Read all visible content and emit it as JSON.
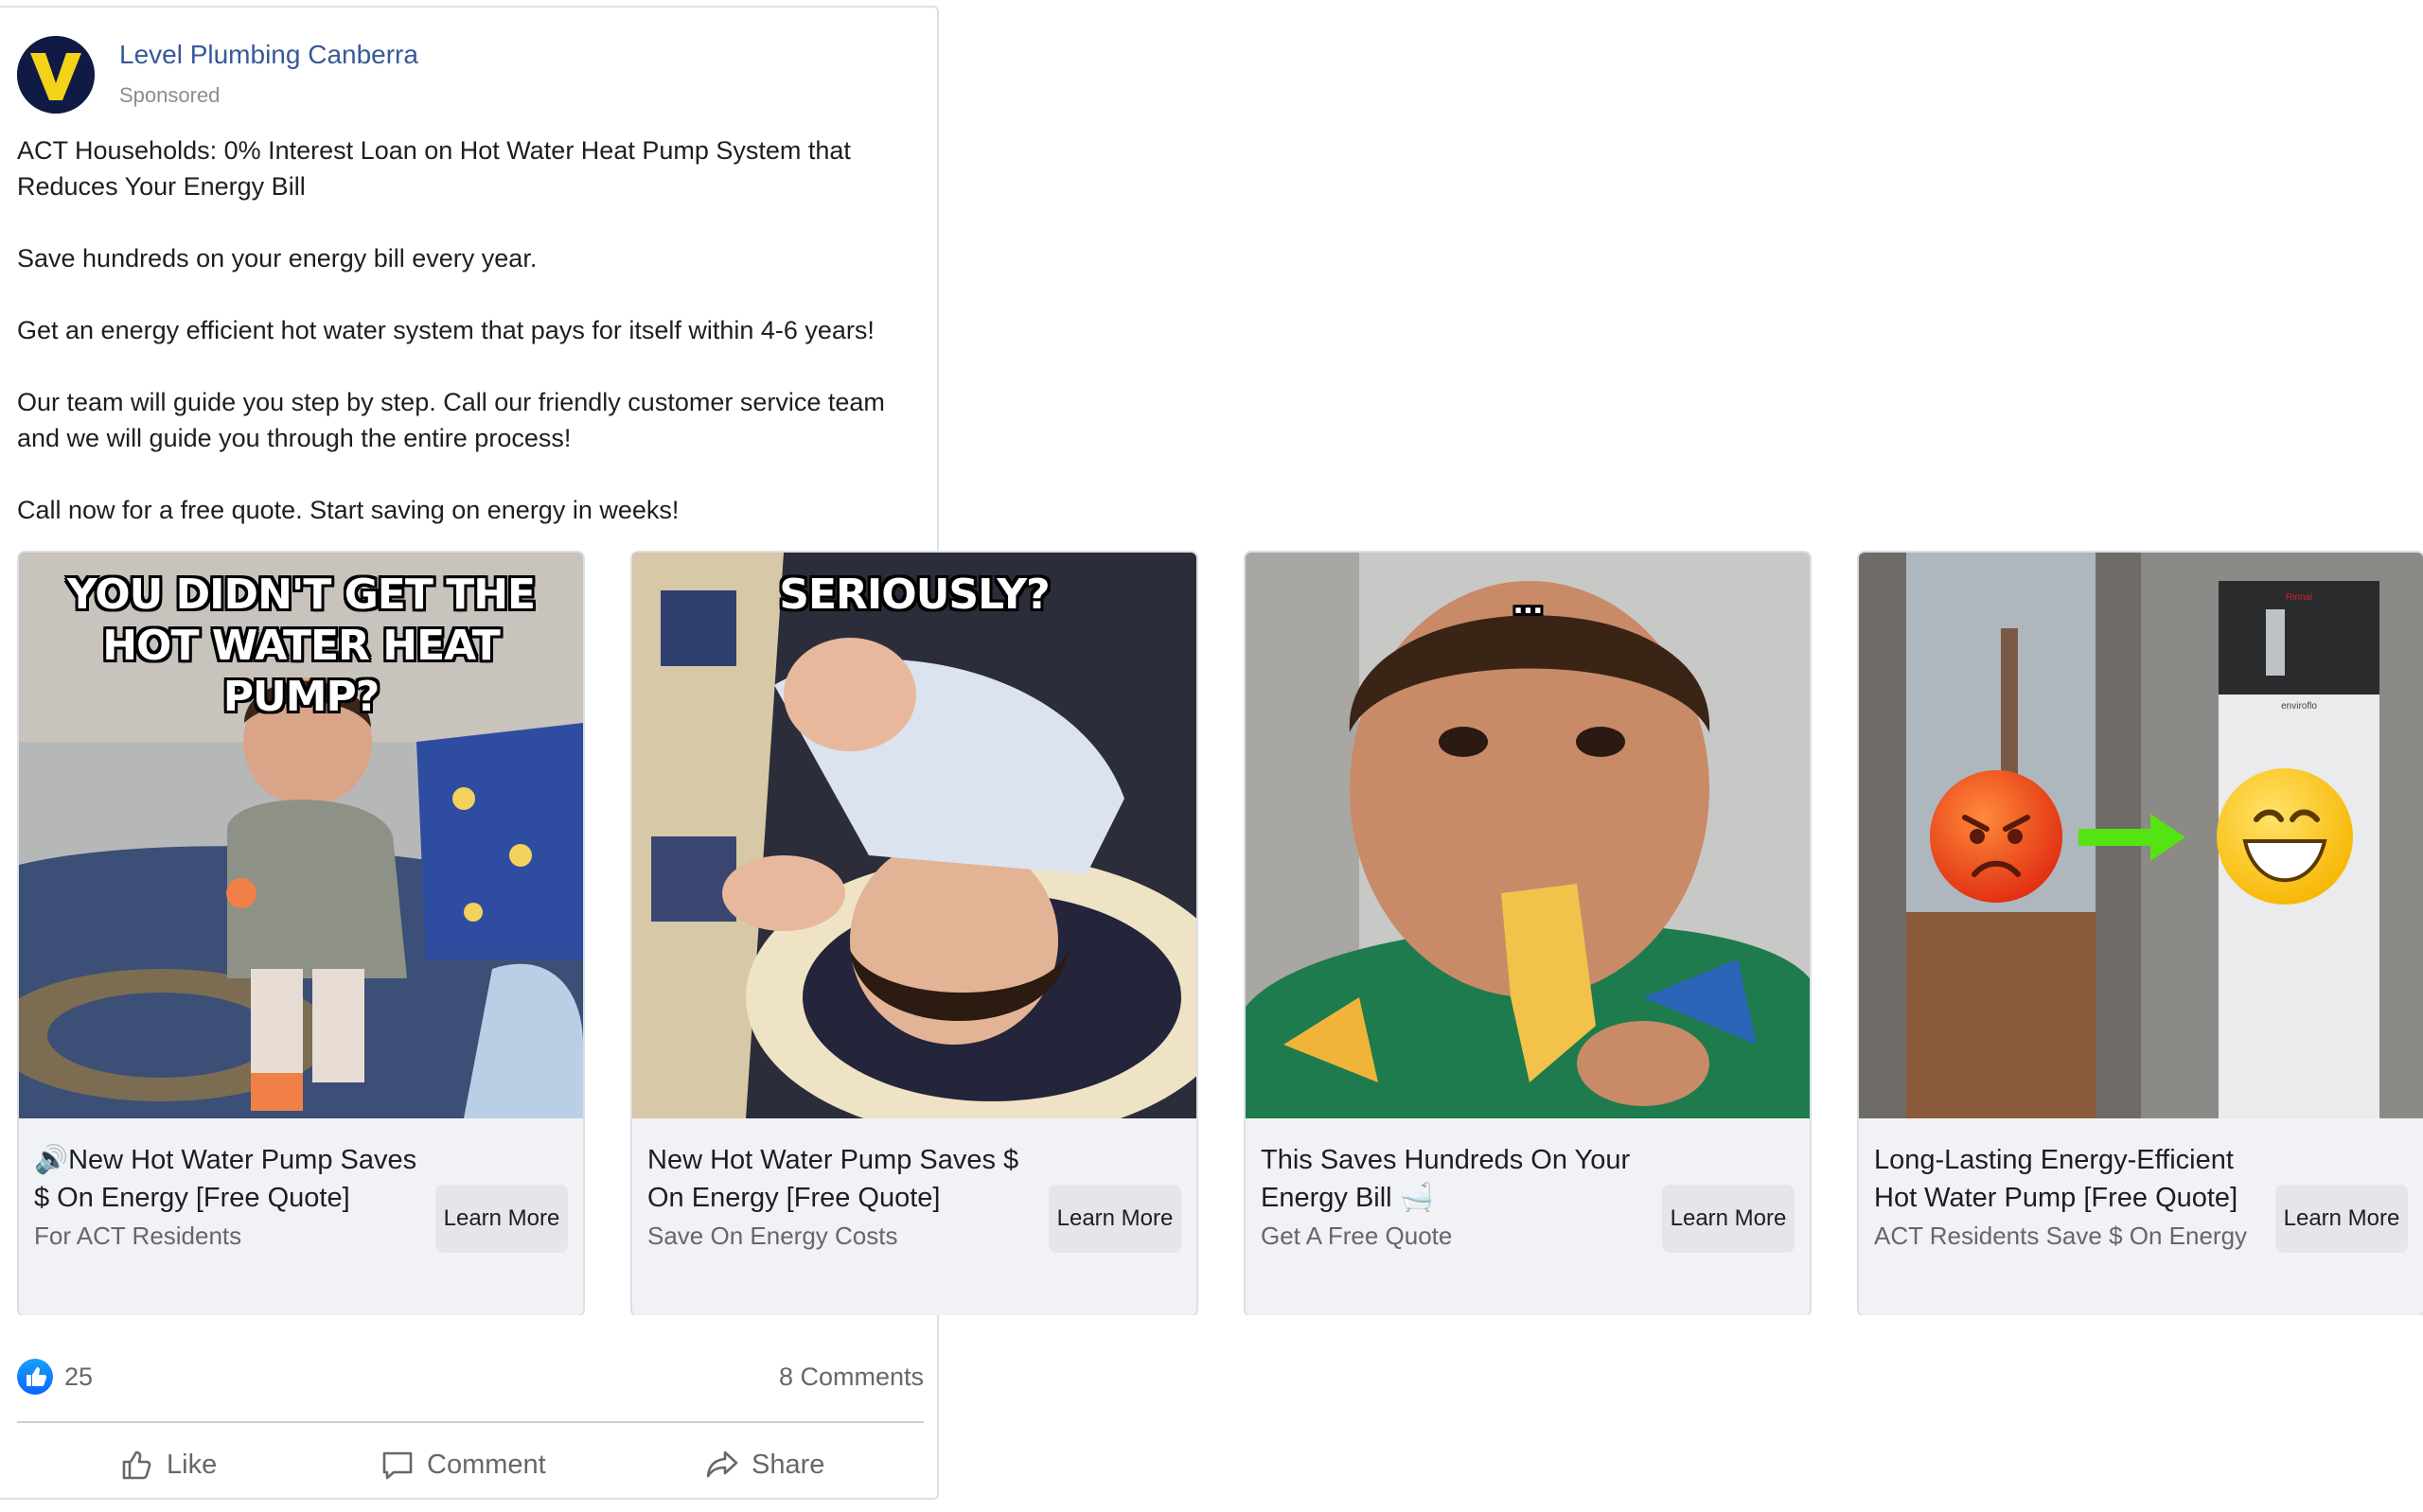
{
  "post": {
    "page_name": "Level Plumbing Canberra",
    "sponsored_label": "Sponsored",
    "avatar_letter": "V",
    "body": "ACT Households: 0% Interest Loan on Hot Water Heat Pump System that Reduces Your Energy Bill\n\nSave hundreds on your energy bill every year.\n\nGet an energy efficient hot water system that pays for itself within 4-6 years!\n\nOur team will guide you step by step. Call our friendly customer service team and we will guide you through the entire process!\n\nCall now for a free quote. Start saving on energy in weeks!"
  },
  "cards": [
    {
      "image_caption": "YOU DIDN'T GET THE HOT WATER HEAT PUMP?",
      "title": "🔊New Hot Water Pump Saves $ On Energy [Free Quote]",
      "subtitle": "For ACT Residents",
      "cta": "Learn More"
    },
    {
      "image_caption": "SERIOUSLY?",
      "title": "New Hot Water Pump Saves $ On Energy [Free Quote]",
      "subtitle": "Save On Energy Costs",
      "cta": "Learn More"
    },
    {
      "image_caption": "...",
      "title": "This Saves Hundreds On Your Energy Bill 🛁",
      "subtitle": "Get A Free Quote",
      "cta": "Learn More"
    },
    {
      "image_brand_top": "Rinnai",
      "image_brand_mid": "enviroflo",
      "title": "Long-Lasting Energy-Efficient Hot Water Pump [Free Quote]",
      "subtitle": "ACT Residents Save $ On Energy",
      "cta": "Learn More"
    }
  ],
  "footer": {
    "reaction_count": "25",
    "comments": "8 Comments",
    "like_label": "Like",
    "comment_label": "Comment",
    "share_label": "Share"
  },
  "colors": {
    "link_blue": "#385898",
    "like_blue": "#0866ff",
    "muted": "#65676b",
    "card_bg": "#f0f2f5",
    "button_bg": "#e4e6eb"
  }
}
